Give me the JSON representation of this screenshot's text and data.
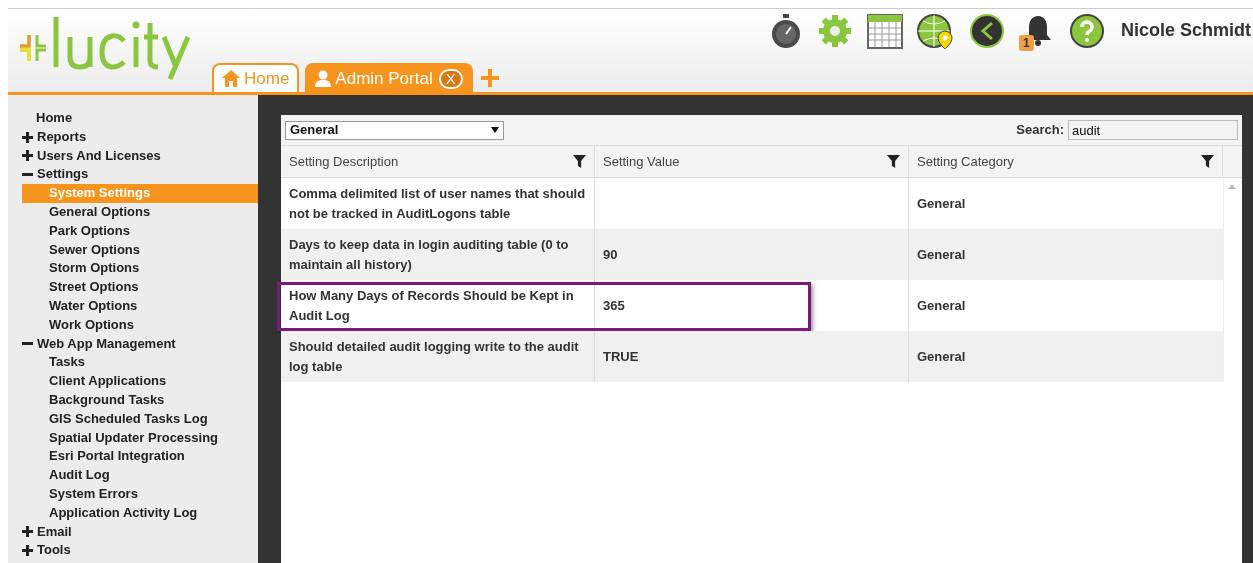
{
  "header": {
    "user_name": "Nicole Schmidt",
    "notification_count": "1"
  },
  "tabs": [
    {
      "label": "Home",
      "selected": false
    },
    {
      "label": "Admin Portal",
      "selected": true,
      "close_label": "X"
    }
  ],
  "sidebar": {
    "items": [
      {
        "label": "Home",
        "kind": "link"
      },
      {
        "label": "Reports",
        "kind": "group",
        "expanded": false
      },
      {
        "label": "Users And Licenses",
        "kind": "group",
        "expanded": false
      },
      {
        "label": "Settings",
        "kind": "group",
        "expanded": true,
        "children": [
          {
            "label": "System Settings",
            "selected": true
          },
          {
            "label": "General Options",
            "selected": false
          },
          {
            "label": "Park Options",
            "selected": false
          },
          {
            "label": "Sewer Options",
            "selected": false
          },
          {
            "label": "Storm Options",
            "selected": false
          },
          {
            "label": "Street Options",
            "selected": false
          },
          {
            "label": "Water Options",
            "selected": false
          },
          {
            "label": "Work Options",
            "selected": false
          }
        ]
      },
      {
        "label": "Web App Management",
        "kind": "group",
        "expanded": true,
        "children": [
          {
            "label": "Tasks",
            "selected": false
          },
          {
            "label": "Client Applications",
            "selected": false
          },
          {
            "label": "Background Tasks",
            "selected": false
          },
          {
            "label": "GIS Scheduled Tasks Log",
            "selected": false
          },
          {
            "label": "Spatial Updater Processing",
            "selected": false
          },
          {
            "label": "Esri Portal Integration",
            "selected": false
          },
          {
            "label": "Audit Log",
            "selected": false
          },
          {
            "label": "System Errors",
            "selected": false
          },
          {
            "label": "Application Activity Log",
            "selected": false
          }
        ]
      },
      {
        "label": "Email",
        "kind": "group",
        "expanded": false
      },
      {
        "label": "Tools",
        "kind": "group",
        "expanded": false
      }
    ]
  },
  "filter": {
    "category": "General",
    "search_label": "Search:",
    "search_value": "audit"
  },
  "table": {
    "columns": [
      "Setting Description",
      "Setting Value",
      "Setting Category"
    ],
    "rows": [
      {
        "description": "Comma delimited list of user names that should not be tracked in AuditLogons table",
        "category": "General",
        "highlighted": false
      },
      {
        "description": "Days to keep data in login auditing table (0 to maintain all history)",
        "value": "90",
        "category": "General",
        "highlighted": false
      },
      {
        "description": "How Many Days of Records Should be Kept in Audit Log",
        "value": "365",
        "category": "General",
        "highlighted": true
      },
      {
        "description": "Should detailed audit logging write to the audit log table",
        "value": "TRUE",
        "category": "General",
        "highlighted": false
      }
    ]
  }
}
